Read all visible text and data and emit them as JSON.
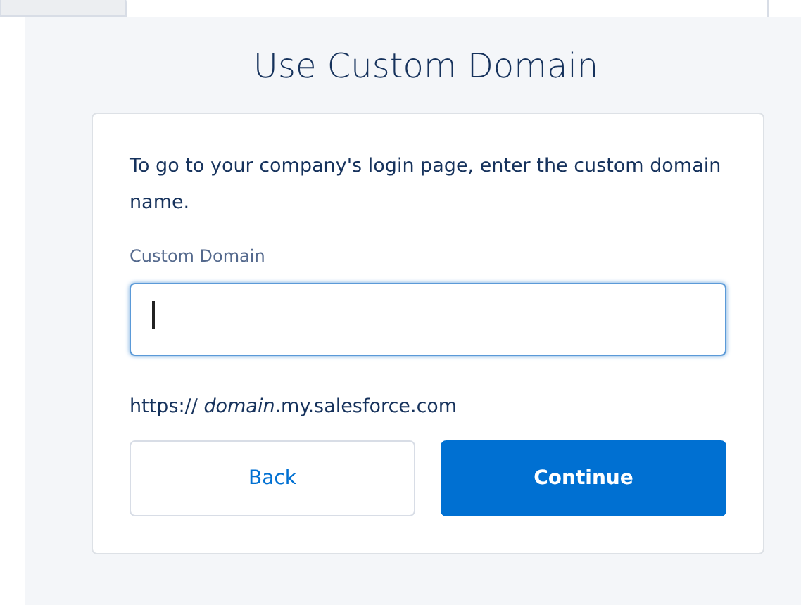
{
  "dialog": {
    "title": "Use Custom Domain",
    "intro": "To go to your company's login page, enter the custom domain name.",
    "field": {
      "label": "Custom Domain",
      "focused": true
    },
    "hint": "https:// *domain*.my.salesforce.com",
    "buttons": [
      {
        "label": "Back",
        "kind": "neutral"
      },
      {
        "label": "Continue",
        "kind": "brand"
      }
    ]
  }
}
